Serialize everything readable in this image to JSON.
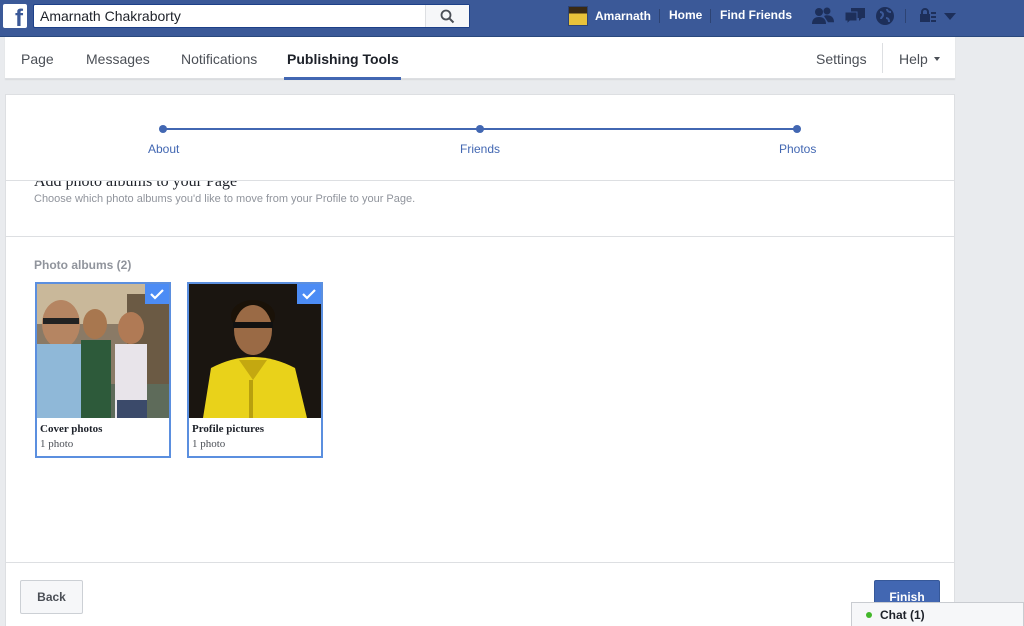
{
  "topbar": {
    "search_value": "Amarnath Chakraborty",
    "user_name": "Amarnath",
    "home_label": "Home",
    "find_friends_label": "Find Friends",
    "icons": [
      "friend-requests-icon",
      "messages-icon",
      "notifications-globe-icon",
      "privacy-lock-icon",
      "account-menu-arrow-icon"
    ]
  },
  "page_tabs": {
    "items": [
      "Page",
      "Messages",
      "Notifications",
      "Publishing Tools"
    ],
    "active": "Publishing Tools",
    "settings_label": "Settings",
    "help_label": "Help"
  },
  "steps": {
    "items": [
      "About",
      "Friends",
      "Photos"
    ]
  },
  "intro": {
    "title": "Add photo albums to your Page",
    "subtitle": "Choose which photo albums you'd like to move from your Profile to your Page."
  },
  "albums": {
    "heading": "Photo albums (2)",
    "items": [
      {
        "name": "Cover photos",
        "count": "1 photo",
        "selected": true
      },
      {
        "name": "Profile pictures",
        "count": "1 photo",
        "selected": true
      }
    ]
  },
  "footer": {
    "back_label": "Back",
    "finish_label": "Finish"
  },
  "chat": {
    "label": "Chat (1)"
  },
  "colors": {
    "brand": "#3b5998",
    "accent": "#4267b2",
    "check": "#4c8cf5",
    "online": "#42b72a"
  }
}
